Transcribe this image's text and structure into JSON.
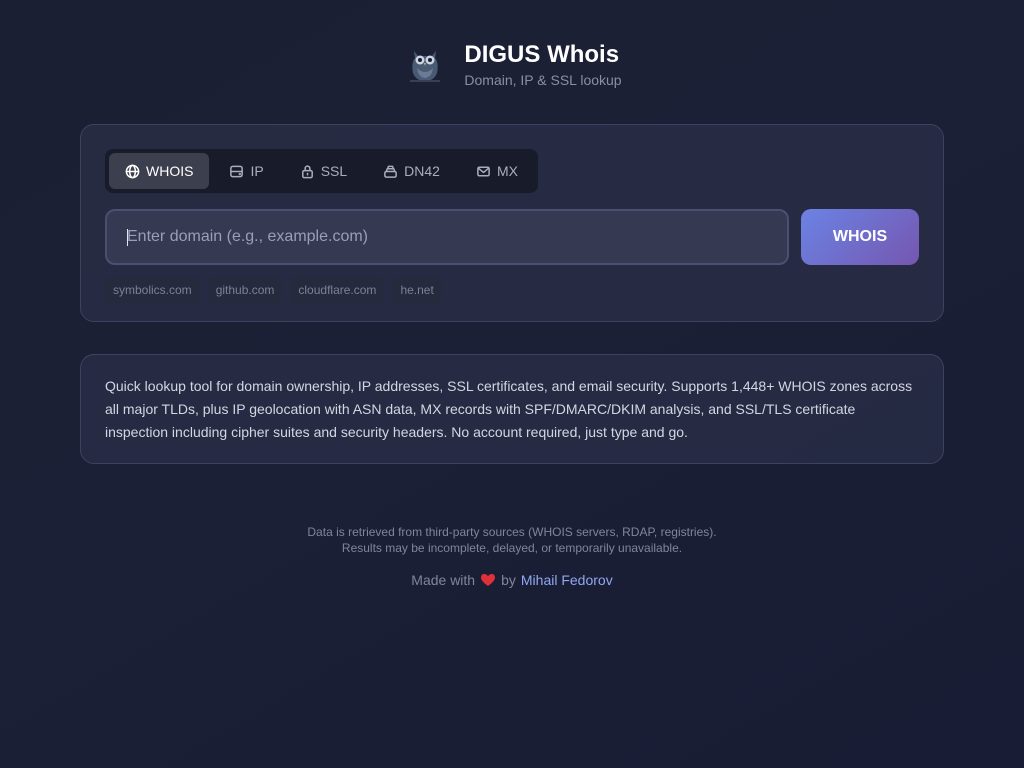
{
  "header": {
    "logo_icon": "owl-icon",
    "title": "DIGUS Whois",
    "subtitle": "Domain, IP & SSL lookup"
  },
  "tabs": [
    {
      "label": "WHOIS",
      "icon": "globe-icon",
      "active": true
    },
    {
      "label": "IP",
      "icon": "server-icon",
      "active": false
    },
    {
      "label": "SSL",
      "icon": "lock-icon",
      "active": false
    },
    {
      "label": "DN42",
      "icon": "stack-icon",
      "active": false
    },
    {
      "label": "MX",
      "icon": "mail-icon",
      "active": false
    }
  ],
  "search": {
    "placeholder": "Enter domain (e.g., example.com)",
    "value": "",
    "button_label": "WHOIS"
  },
  "examples": [
    "symbolics.com",
    "github.com",
    "cloudflare.com",
    "he.net"
  ],
  "info": {
    "text": "Quick lookup tool for domain ownership, IP addresses, SSL certificates, and email security. Supports 1,448+ WHOIS zones across all major TLDs, plus IP geolocation with ASN data, MX records with SPF/DMARC/DKIM analysis, and SSL/TLS certificate inspection including cipher suites and security headers. No account required, just type and go."
  },
  "footer": {
    "disclaimer_line1": "Data is retrieved from third-party sources (WHOIS servers, RDAP, registries).",
    "disclaimer_line2": "Results may be incomplete, delayed, or temporarily unavailable.",
    "made_with": "Made with",
    "heart_icon": "heart-icon",
    "by": "by",
    "author": "Mihail Fedorov"
  },
  "colors": {
    "accent_start": "#6b83e4",
    "accent_end": "#7557b0",
    "link": "#8fa8f0",
    "heart": "#e0303a"
  }
}
